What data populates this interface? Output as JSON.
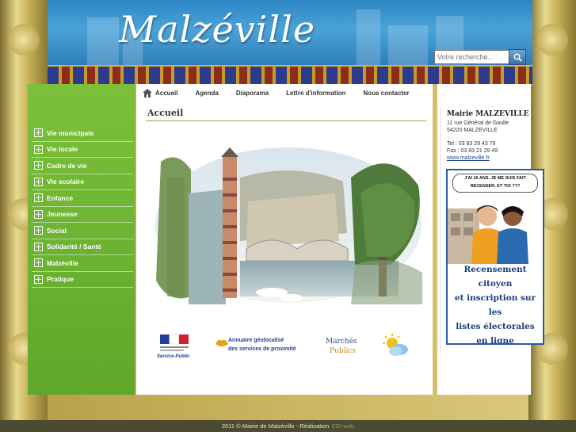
{
  "site": {
    "title": "Malzéville"
  },
  "search": {
    "placeholder": "Votre recherche..."
  },
  "topnav": [
    {
      "label": "Accueil"
    },
    {
      "label": "Agenda"
    },
    {
      "label": "Diaporama"
    },
    {
      "label": "Lettre d'information"
    },
    {
      "label": "Nous contacter"
    }
  ],
  "sidebar": {
    "items": [
      {
        "label": "Vie municipale"
      },
      {
        "label": "Vie locale"
      },
      {
        "label": "Cadre de vie"
      },
      {
        "label": "Vie scolaire"
      },
      {
        "label": "Enfance"
      },
      {
        "label": "Jeunesse"
      },
      {
        "label": "Social"
      },
      {
        "label": "Solidarité / Santé"
      },
      {
        "label": "Malzéville"
      },
      {
        "label": "Pratique"
      }
    ]
  },
  "main": {
    "page_title": "Accueil",
    "logos": {
      "annuaire_line1": "Annuaire géolocalisé",
      "annuaire_line2": "des services de proximité",
      "marches_line1": "Marchés",
      "marches_line2": "Publics",
      "service_public": "Service-Public"
    }
  },
  "contact": {
    "title": "Mairie MALZEVILLE",
    "address1": "11 rue Général de Gaulle",
    "address2": "54220 MALZEVILLE",
    "tel": "Tel : 03 83 29 43 78",
    "fax": "Fax : 03 83 21 29 49",
    "website": "www.malzeville.fr"
  },
  "census": {
    "bubble": "J'AI 16 ANS. JE ME SUIS FAIT RECENSER, ET TOI ???",
    "line1": "Recensement citoyen",
    "line2": "et inscription sur les",
    "line3": "listes électorales",
    "line4": "en ligne"
  },
  "footer": {
    "text": "2011 © Mairie de Malzéville - Réalisation",
    "agency": "CSI-web"
  },
  "colors": {
    "sidebar_green": "#6bb532",
    "header_blue": "#3a95d0",
    "census_blue": "#1a3d7a"
  }
}
